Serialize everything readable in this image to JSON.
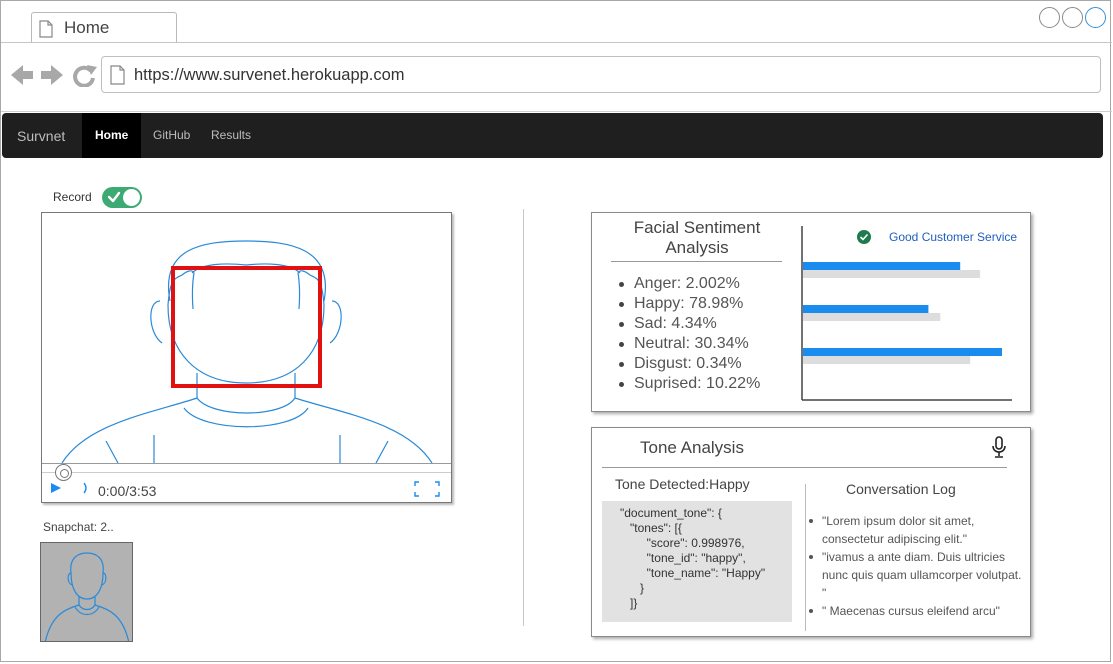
{
  "browser": {
    "tab_title": "Home",
    "url": "https://www.survenet.herokuapp.com"
  },
  "navbar": {
    "brand": "Survnet",
    "items": [
      {
        "label": "Home",
        "active": true
      },
      {
        "label": "GitHub",
        "active": false
      },
      {
        "label": "Results",
        "active": false
      }
    ]
  },
  "record": {
    "label": "Record",
    "enabled": true
  },
  "video": {
    "time": "0:00/3:53",
    "progress": 0
  },
  "snapshot": {
    "label": "Snapchat: 2.."
  },
  "facial_sentiment": {
    "title": "Facial Sentiment Analysis",
    "emotions": [
      "Anger: 2.002%",
      "Happy: 78.98%",
      "Sad: 4.34%",
      "Neutral: 30.34%",
      "Disgust: 0.34%",
      "Suprised: 10.22%"
    ],
    "legend": "Good Customer Service",
    "chart_data": {
      "type": "bar",
      "orientation": "horizontal",
      "series": [
        {
          "color": "#1a8cf0",
          "values": [
            0.79,
            0.63,
            1.0
          ]
        },
        {
          "color": "#dddddd",
          "values": [
            0.89,
            0.69,
            0.84
          ]
        }
      ]
    }
  },
  "tone": {
    "title": "Tone Analysis",
    "detected": "Tone Detected:Happy",
    "json_lines": [
      "\"document_tone\": {",
      "   \"tones\": [{",
      "        \"score\": 0.998976,",
      "        \"tone_id\": \"happy\",",
      "        \"tone_name\": \"Happy\"",
      "      }",
      "   ]}"
    ],
    "conversation_title": "Conversation Log",
    "conversation": [
      "\"Lorem ipsum dolor sit amet, consectetur adipiscing elit.\"",
      "\"ivamus a ante diam. Duis ultricies nunc quis quam ullamcorper volutpat. \"",
      "\" Maecenas cursus eleifend arcu\""
    ]
  },
  "colors": {
    "navbar": "#1f1f1f",
    "toggle_on": "#3eaa73",
    "face_box": "#e21111",
    "sketch": "#2a8ad8",
    "link": "#1f5fbf"
  }
}
